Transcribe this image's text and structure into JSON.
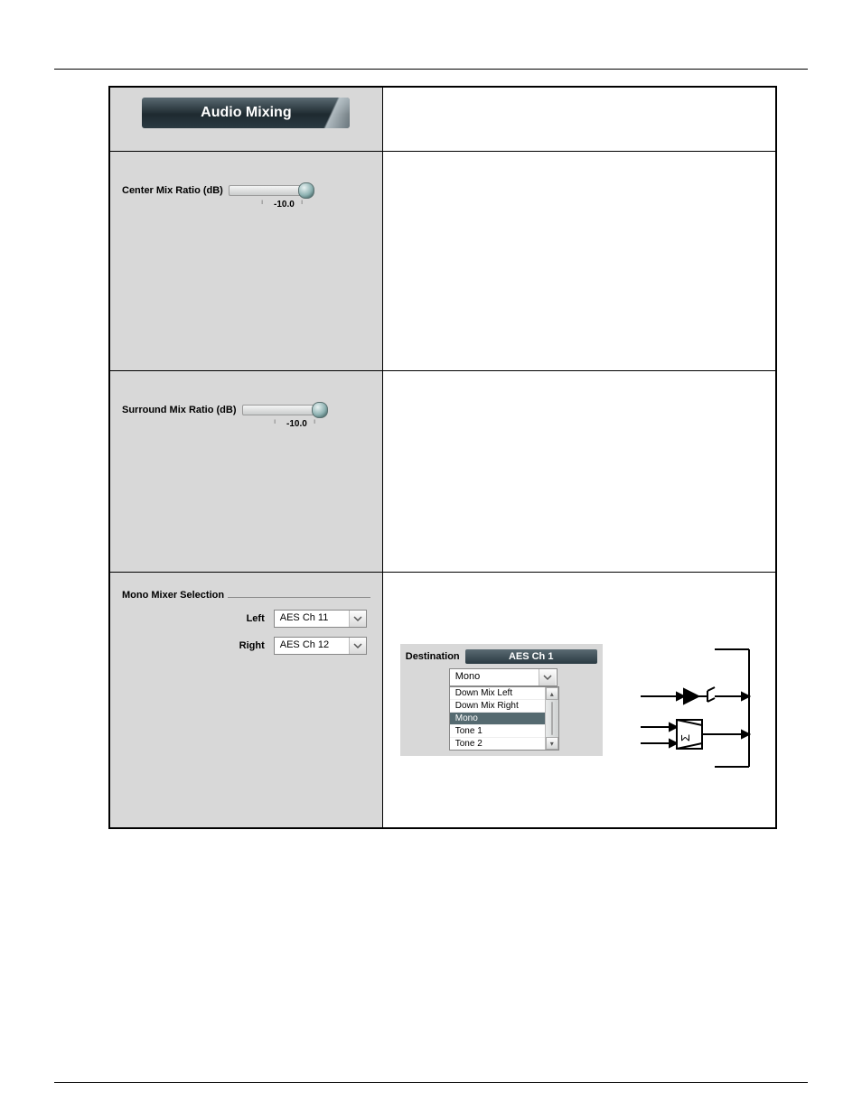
{
  "banner": {
    "title": "Audio Mixing"
  },
  "center_mix": {
    "label": "Center Mix Ratio (dB)",
    "value": "-10.0"
  },
  "surround_mix": {
    "label": "Surround Mix Ratio (dB)",
    "value": "-10.0"
  },
  "mono": {
    "legend": "Mono Mixer Selection",
    "left_label": "Left",
    "right_label": "Right",
    "left_value": "AES Ch 11",
    "right_value": "AES Ch 12"
  },
  "dest": {
    "label": "Destination",
    "channel": "AES Ch 1",
    "selected_combo": "Mono",
    "options": [
      "Down Mix Left",
      "Down Mix Right",
      "Mono",
      "Tone 1",
      "Tone 2"
    ]
  },
  "diagram": {
    "sigma": "Σ"
  }
}
